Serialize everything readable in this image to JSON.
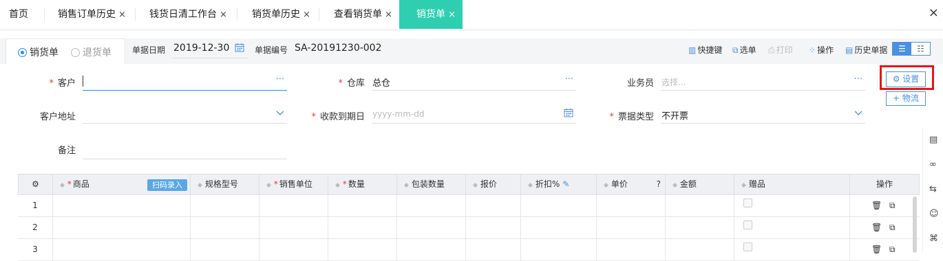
{
  "tabs": [
    {
      "label": "首页",
      "closable": false,
      "active": false
    },
    {
      "label": "销售订单历史",
      "closable": true,
      "active": false
    },
    {
      "label": "钱货日清工作台",
      "closable": true,
      "active": false
    },
    {
      "label": "销货单历史",
      "closable": true,
      "active": false
    },
    {
      "label": "查看销货单",
      "closable": true,
      "active": false
    },
    {
      "label": "销货单",
      "closable": true,
      "active": true
    }
  ],
  "close_glyph": "×",
  "toolbar": {
    "radio_sales": "销货单",
    "radio_return": "退货单",
    "selected_doc_type": "销货单",
    "date_label": "单据日期",
    "date_value": "2019-12-30",
    "number_label": "单据编号",
    "number_value": "SA-20191230-002",
    "actions": [
      {
        "label": "快捷键",
        "icon": "keyboard-icon",
        "disabled": false
      },
      {
        "label": "选单",
        "icon": "select-doc-icon",
        "disabled": false
      },
      {
        "label": "打印",
        "icon": "print-icon",
        "disabled": true
      },
      {
        "label": "操作",
        "icon": "grid-menu-icon",
        "disabled": false
      },
      {
        "label": "历史单据",
        "icon": "history-icon",
        "disabled": false
      }
    ],
    "view_mode": "list"
  },
  "form": {
    "customer_label": "客户",
    "customer_value": "",
    "warehouse_label": "仓库",
    "warehouse_value": "总仓",
    "salesperson_label": "业务员",
    "salesperson_placeholder": "选择...",
    "customer_address_label": "客户地址",
    "due_date_label": "收款到期日",
    "due_date_placeholder": "yyyy-mm-dd",
    "invoice_type_label": "票据类型",
    "invoice_type_value": "不开票",
    "remark_label": "备注",
    "ellipsis": "···",
    "required_mark": "*"
  },
  "buttons": {
    "settings": "设置",
    "logistics": "物流",
    "scan_entry": "扫码录入"
  },
  "table": {
    "columns": [
      "商品",
      "规格型号",
      "销售单位",
      "数量",
      "包装数量",
      "报价",
      "折扣%",
      "单价",
      "金额",
      "赠品",
      "操作"
    ],
    "required_columns": [
      "商品",
      "销售单位",
      "数量"
    ],
    "rows": [
      "1",
      "2",
      "3"
    ]
  },
  "colors": {
    "accent_tab": "#2ecfb0",
    "primary_blue": "#4a90d9",
    "required_red": "#e5393b",
    "highlight_red": "#e8131b"
  }
}
